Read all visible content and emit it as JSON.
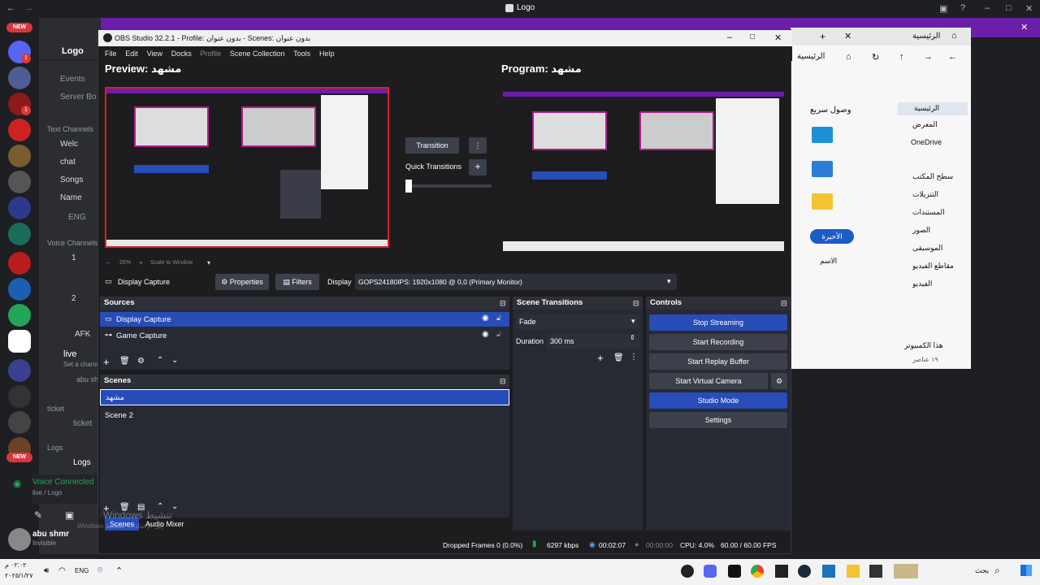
{
  "discord": {
    "title": "Logo",
    "new_badge": "NEW",
    "badge_count": "1",
    "server_name": "Logo",
    "channels": [
      "Events",
      "Server Bo",
      "Text Channels",
      "Welc",
      "chat",
      "Songs",
      "Name",
      "ENG",
      "Voice Channels",
      "1",
      "2",
      "AFK",
      "live",
      "Set a channe",
      "abu sh",
      "ticket",
      "ticket",
      "Logs",
      "Logs"
    ],
    "voice_connected": "Voice Connected",
    "voice_server": "live / Logo",
    "user_name": "abu shmr",
    "user_status": "Invisible"
  },
  "browser": {
    "tab_label": "الرئيسية",
    "address": "الرئيسية",
    "quick_access": "وصول سريع",
    "sidebar": [
      "الرئيسية",
      "المعرض",
      "OneDrive",
      "سطح المكتب",
      "التنزيلات",
      "المستندات",
      "الصور",
      "الموسيقى",
      "مقاطع الفيديو",
      "الفيديو"
    ],
    "recent_label": "الأخيرة",
    "name_col": "الاسم",
    "footer": "هذا الكمبيوتر",
    "items_count": "١٩ عناصر"
  },
  "obs": {
    "title": "OBS Studio 32.2.1 - Profile: بدون عنوان - Scenes: بدون عنوان",
    "menu": [
      "File",
      "Edit",
      "View",
      "Docks",
      "Profile",
      "Scene Collection",
      "Tools",
      "Help"
    ],
    "preview_label": "Preview: مشهد",
    "program_label": "Program: مشهد",
    "transition_btn": "Transition",
    "quick_transitions": "Quick Transitions",
    "zoom_text": "26%",
    "scale_text": "Scale to Window",
    "source_bar": {
      "source_name": "Display Capture",
      "properties": "Properties",
      "filters": "Filters",
      "display_label": "Display",
      "display_value": "GOPS24180IPS: 1920x1080 @ 0,0 (Primary Monitor)"
    },
    "sources": {
      "title": "Sources",
      "items": [
        "Display Capture",
        "Game Capture"
      ]
    },
    "scenes": {
      "title": "Scenes",
      "items": [
        "مشهد",
        "Scene 2"
      ]
    },
    "bottom_tabs": [
      "Scenes",
      "Audio Mixer"
    ],
    "scene_transitions": {
      "title": "Scene Transitions",
      "selected": "Fade",
      "duration_label": "Duration",
      "duration_value": "300 ms"
    },
    "controls": {
      "title": "Controls",
      "buttons": [
        "Stop Streaming",
        "Start Recording",
        "Start Replay Buffer",
        "Start Virtual Camera",
        "Studio Mode",
        "Settings"
      ]
    },
    "status": {
      "dropped": "Dropped Frames 0 (0.0%)",
      "bitrate": "6297 kbps",
      "stream_time": "00:02:07",
      "rec_time": "00:00:00",
      "cpu": "CPU: 4.0%",
      "fps": "60.00 / 60.00 FPS"
    }
  },
  "watermark": {
    "line1": "Windows تنشيط",
    "line2": "Windows إلى الإعدادات لتنشيط"
  },
  "taskbar": {
    "time": "٠٢:٠٢ م",
    "date": "٢٠٢٥/١/٢٧",
    "lang": "ENG",
    "search": "بحث"
  },
  "colors": {
    "accent_blue": "#284cb8",
    "preview_border": "#e01e1e",
    "discord_red": "#da373c",
    "purple": "#6b1fa8"
  }
}
